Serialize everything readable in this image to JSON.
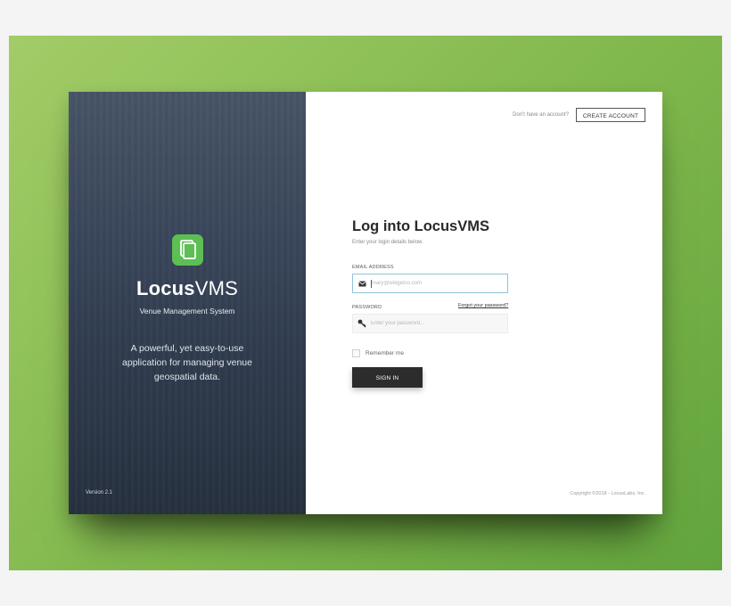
{
  "brand": {
    "logo_bold": "Locus",
    "logo_light": "VMS",
    "subtitle": "Venue Management System",
    "tagline": "A powerful, yet easy-to-use application for managing venue geospatial data.",
    "version": "Version 2.1",
    "icon": "document-copy-icon",
    "icon_color": "#5cbf53"
  },
  "header": {
    "prompt": "Don't have an account?",
    "create_account_label": "CREATE ACCOUNT"
  },
  "login": {
    "title": "Log into LocusVMS",
    "subtitle": "Enter your login details below.",
    "email_label": "EMAIL ADDRESS",
    "email_placeholder": "mary@widgetco.com",
    "email_value": "",
    "password_label": "PASSWORD",
    "forgot_label": "Forgot your password?",
    "password_placeholder": "Enter your password...",
    "remember_label": "Remember me",
    "remember_checked": false,
    "signin_label": "SIGN IN"
  },
  "footer": {
    "copyright": "Copyright ©2018 - LocusLabs, Inc."
  },
  "colors": {
    "background_green": "#7fb74c",
    "panel_dark": "#2f3b4d",
    "button_dark": "#2c2c2c",
    "email_focus_border": "#8fc4d8"
  }
}
